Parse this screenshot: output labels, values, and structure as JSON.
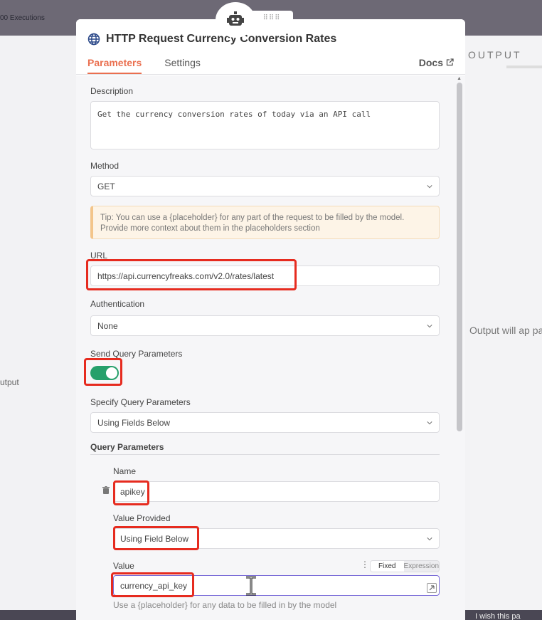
{
  "background": {
    "executions_text": "00 Executions",
    "left_panel_text": "utput",
    "right_panel_title": "OUTPUT",
    "right_panel_text": "Output will ap parent",
    "bottom_right_text": "I wish this pa"
  },
  "panel": {
    "title": "HTTP Request Currency Conversion Rates",
    "tabs": [
      "Parameters",
      "Settings"
    ],
    "active_tab": "Parameters",
    "docs_label": "Docs"
  },
  "form": {
    "description_label": "Description",
    "description_value": "Get the currency conversion rates of today via an API call",
    "method_label": "Method",
    "method_value": "GET",
    "tip": "Tip: You can use a {placeholder} for any part of the request to be filled by the model. Provide more context about them in the placeholders section",
    "url_label": "URL",
    "url_value": "https://api.currencyfreaks.com/v2.0/rates/latest",
    "auth_label": "Authentication",
    "auth_value": "None",
    "send_query_label": "Send Query Parameters",
    "send_query_enabled": true,
    "specify_query_label": "Specify Query Parameters",
    "specify_query_value": "Using Fields Below",
    "query_params_label": "Query Parameters",
    "name_label": "Name",
    "name_value": "apikey",
    "value_provided_label": "Value Provided",
    "value_provided_value": "Using Field Below",
    "value_label": "Value",
    "value_mode_fixed": "Fixed",
    "value_mode_expression": "Expression",
    "value_value": "currency_api_key",
    "value_hint": "Use a {placeholder} for any data to be filled in by the model"
  },
  "colors": {
    "accent": "#ea6f4f",
    "toggle_on": "#26a06b",
    "highlight": "#e62b1f"
  }
}
